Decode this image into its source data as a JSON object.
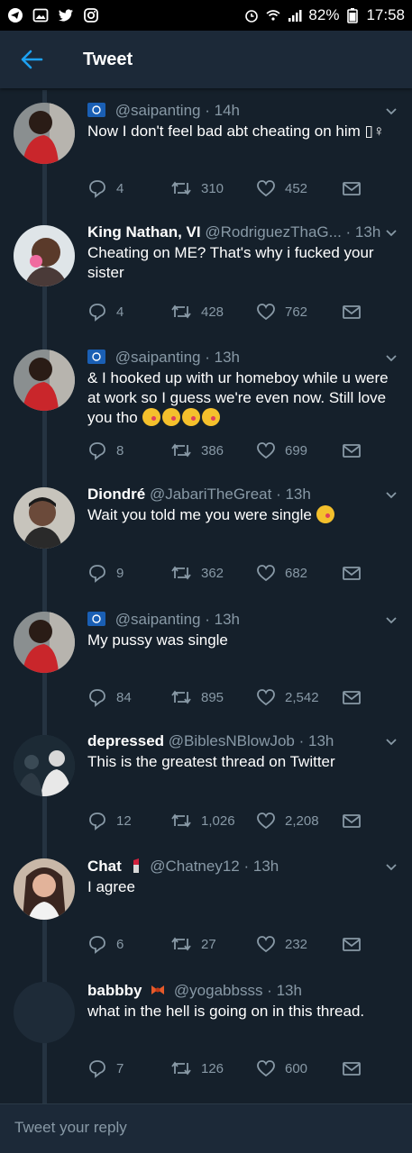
{
  "status_bar": {
    "battery": "82%",
    "time": "17:58"
  },
  "header": {
    "title": "Tweet"
  },
  "tweets": [
    {
      "name": "",
      "handle": "@saipanting",
      "time": "14h",
      "text": "Now I don't feel bad abt cheating on him ▯♀",
      "replies": "4",
      "retweets": "310",
      "likes": "452"
    },
    {
      "name": "King Nathan, VI",
      "handle": "@RodriguezThaG...",
      "time": "13h",
      "text": "Cheating on ME? That's why i fucked your sister",
      "replies": "4",
      "retweets": "428",
      "likes": "762"
    },
    {
      "name": "",
      "handle": "@saipanting",
      "time": "13h",
      "text": "& I hooked up with ur homeboy while u were at work so I guess we're even now. Still love you tho",
      "replies": "8",
      "retweets": "386",
      "likes": "699"
    },
    {
      "name": "Diondré",
      "handle": "@JabariTheGreat",
      "time": "13h",
      "text": "Wait you told me you were single",
      "replies": "9",
      "retweets": "362",
      "likes": "682"
    },
    {
      "name": "",
      "handle": "@saipanting",
      "time": "13h",
      "text": "My pussy was single",
      "replies": "84",
      "retweets": "895",
      "likes": "2,542"
    },
    {
      "name": "depressed",
      "handle": "@BiblesNBlowJob",
      "time": "13h",
      "text": "This is the greatest thread on Twitter",
      "replies": "12",
      "retweets": "1,026",
      "likes": "2,208"
    },
    {
      "name": "Chat",
      "handle": "@Chatney12",
      "time": "13h",
      "text": "I agree",
      "replies": "6",
      "retweets": "27",
      "likes": "232"
    },
    {
      "name": "babbby",
      "handle": "@yogabbsss",
      "time": "13h",
      "text": "what in the hell is going on in this thread.",
      "replies": "7",
      "retweets": "126",
      "likes": "600"
    }
  ],
  "compose": {
    "placeholder": "Tweet your reply"
  },
  "colors": {
    "background": "#15202b",
    "bar": "#1c2938",
    "accent": "#1da1f2",
    "muted": "#8899a6"
  }
}
